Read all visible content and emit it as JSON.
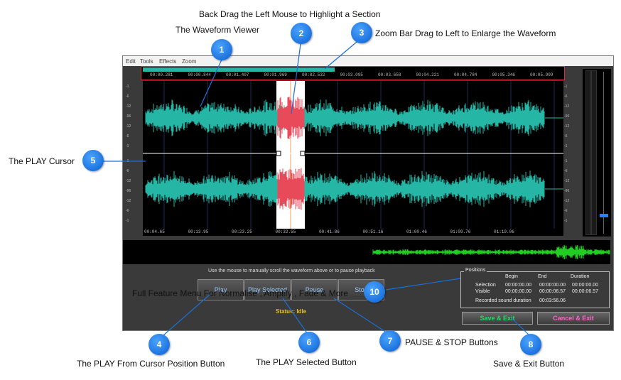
{
  "annotations": {
    "back_drag": "Back Drag the Left Mouse to Highlight a Section",
    "waveform_viewer": "The Waveform Viewer",
    "zoom_bar": "Zoom Bar Drag to Left to Enlarge the Waveform",
    "play_cursor": "The PLAY Cursor",
    "play_from_cursor": "The PLAY From Cursor Position Button",
    "play_selected_btn": "The PLAY Selected Button",
    "pause_stop": "PAUSE & STOP Buttons",
    "save_exit": "Save & Exit Button",
    "full_feature_menu": "Full Feature Menu For Normalise , Amplify , Fade & More"
  },
  "badges": [
    "1",
    "2",
    "3",
    "4",
    "5",
    "6",
    "7",
    "8",
    "10"
  ],
  "menu": [
    "Edit",
    "Tools",
    "Effects",
    "Zoom"
  ],
  "timeline_top": [
    "00:00.281",
    "00:00.844",
    "00:01.407",
    "00:01.969",
    "00:02.532",
    "00:03.095",
    "00:03.658",
    "00:04.221",
    "00:04.784",
    "00:05.346",
    "00:05.909"
  ],
  "timeline_bottom": [
    "00:04.65",
    "00:13.95",
    "00:23.25",
    "00:32.55",
    "00:41.86",
    "00:51.16",
    "01:00.46",
    "01:09.76",
    "01:19.06"
  ],
  "db_labels": [
    "-1",
    "-6",
    "-12",
    "-96",
    "-12",
    "-6",
    "-1"
  ],
  "hint": "Use the mouse to manually scroll the waveform above or to pause playback",
  "buttons": {
    "play": "Play",
    "play_selected": "Play Selected",
    "pause": "Pause",
    "stop": "Stop"
  },
  "status": "Status: Idle",
  "positions": {
    "title": "Positions",
    "headers": [
      "Begin",
      "End",
      "Duration"
    ],
    "selection": {
      "label": "Selection",
      "begin": "00:00:00.00",
      "end": "00:00:00.00",
      "duration": "00:00:00.00"
    },
    "visible": {
      "label": "Visible",
      "begin": "00:00:00.00",
      "end": "00:00:06.57",
      "duration": "00:00:06.57"
    },
    "recorded_label": "Recorded sound duration",
    "recorded_value": "00:03:56.06"
  },
  "save_exit_btn": "Save & Exit",
  "cancel_exit_btn": "Cancel & Exit",
  "colors": {
    "waveform": "#26b6a6",
    "selection": "#e84a5a",
    "green": "#22cc22",
    "status": "#e8c020",
    "badge": "#1a7ff0"
  }
}
